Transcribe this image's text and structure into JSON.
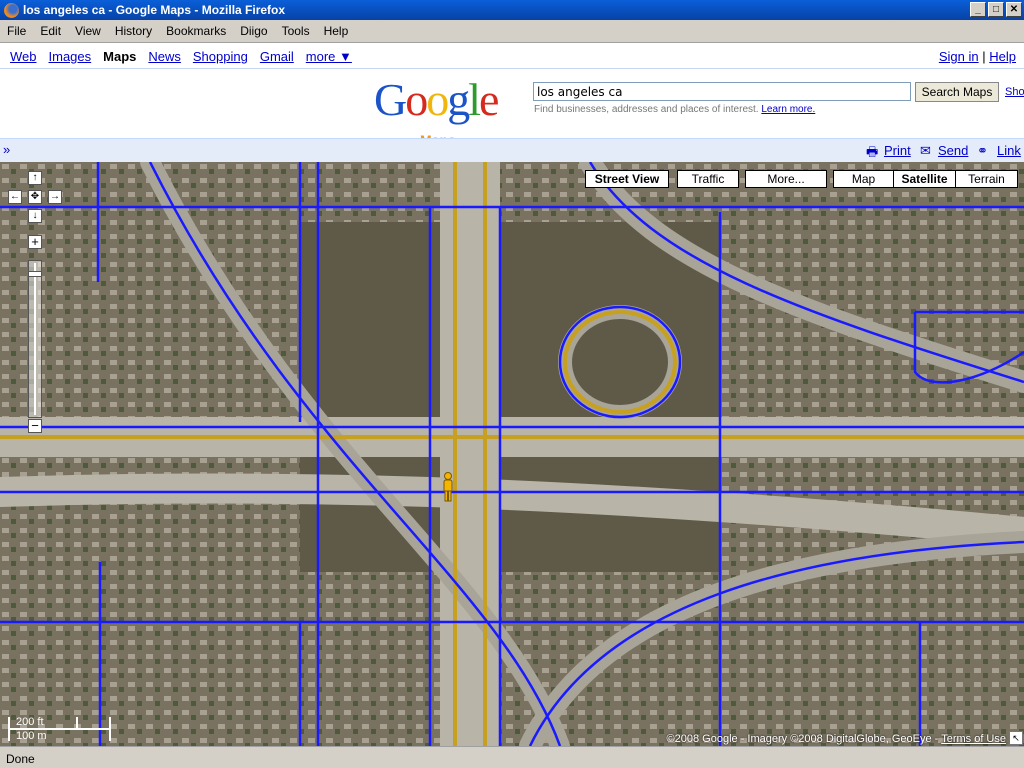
{
  "window": {
    "title": "los angeles ca - Google Maps - Mozilla Firefox"
  },
  "menu": [
    "File",
    "Edit",
    "View",
    "History",
    "Bookmarks",
    "Diigo",
    "Tools",
    "Help"
  ],
  "gbar": {
    "items": [
      "Web",
      "Images",
      "Maps",
      "News",
      "Shopping",
      "Gmail",
      "more ▼"
    ],
    "active": "Maps",
    "sign_in": "Sign in",
    "sep": "|",
    "help": "Help"
  },
  "logo": {
    "text": "Google",
    "sub": "Maps"
  },
  "search": {
    "value": "los angeles ca",
    "button": "Search Maps",
    "show_link": "Sho",
    "hint": "Find businesses, addresses and places of interest.",
    "learn_more": "Learn more."
  },
  "linkbar": {
    "collapse": "»",
    "print": "Print",
    "send": "Send",
    "link": "Link"
  },
  "map": {
    "buttons": {
      "street_view": "Street View",
      "traffic": "Traffic",
      "more": "More...",
      "map": "Map",
      "satellite": "Satellite",
      "terrain": "Terrain"
    },
    "selected_type": "Satellite",
    "scale": {
      "ft": "200 ft",
      "m": "100 m"
    },
    "copyright": "©2008 Google - Imagery ©2008 DigitalGlobe, GeoEye -",
    "terms": "Terms of Use",
    "road_color": "#1a1aff",
    "highway_color": "#c8a020"
  },
  "status": "Done"
}
